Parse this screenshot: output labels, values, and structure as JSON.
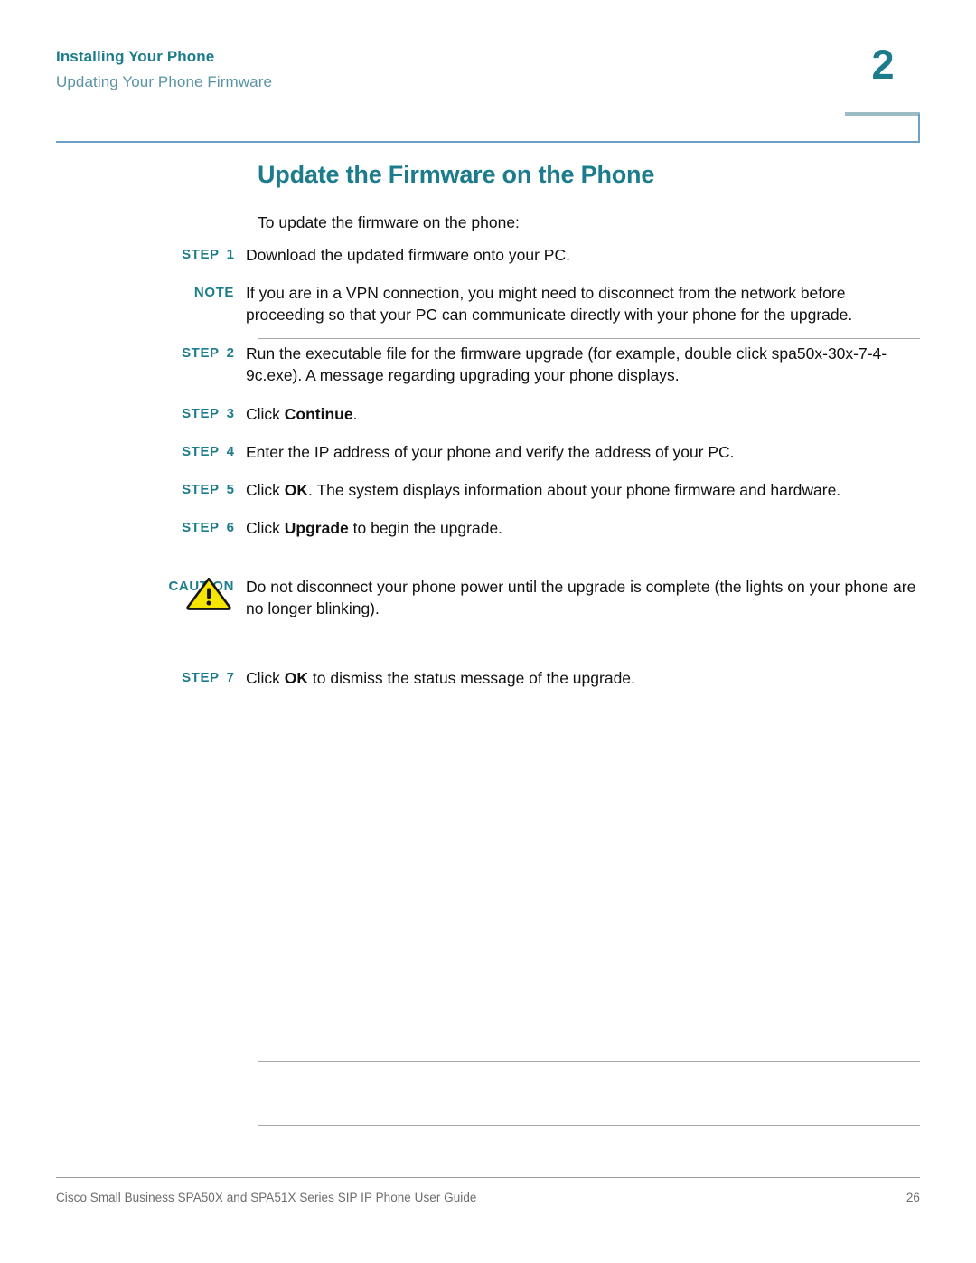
{
  "header": {
    "chapter_title": "Installing Your Phone",
    "section_title": "Updating Your Phone Firmware",
    "chapter_number": "2"
  },
  "main": {
    "section_title": "Update the Firmware on the Phone",
    "intro": "To update the firmware on the phone:",
    "step_label": "STEP",
    "note_label": "NOTE",
    "caution_label": "CAUTION",
    "caution_icon": "warning-triangle-icon",
    "rows": [
      {
        "kind": "step",
        "label": "STEP",
        "number": "1",
        "text": "Download the updated firmware onto your PC."
      },
      {
        "kind": "note",
        "label": "NOTE",
        "number": "",
        "text": "If you are in a VPN connection, you might need to disconnect from the network before proceeding so that your PC can communicate directly with your phone for the upgrade."
      },
      {
        "kind": "step",
        "label": "STEP",
        "number": "2",
        "text": "Run the executable file for the firmware upgrade (for example, double click spa50x-30x-7-4-9c.exe). A message regarding upgrading your phone displays."
      },
      {
        "kind": "step",
        "label": "STEP",
        "number": "3",
        "text_before": "Click ",
        "text_bold": "Continue",
        "text_after": "."
      },
      {
        "kind": "step",
        "label": "STEP",
        "number": "4",
        "text": "Enter the IP address of your phone and verify the address of your PC."
      },
      {
        "kind": "step",
        "label": "STEP",
        "number": "5",
        "text_before": "Click ",
        "text_bold": "OK",
        "text_after": ". The system displays information about your phone firmware and hardware."
      },
      {
        "kind": "step",
        "label": "STEP",
        "number": "6",
        "text_before": "Click ",
        "text_bold": "Upgrade",
        "text_after": " to begin the upgrade."
      },
      {
        "kind": "caution",
        "label": "CAUTION",
        "number": "",
        "text": "Do not disconnect your phone power until the upgrade is complete (the lights on your phone are no longer blinking)."
      },
      {
        "kind": "step",
        "label": "STEP",
        "number": "7",
        "text_before": "Click ",
        "text_bold": "OK",
        "text_after": " to dismiss the status message of the upgrade."
      }
    ]
  },
  "footer": {
    "document_title": "Cisco Small Business SPA50X and SPA51X Series SIP IP Phone User Guide",
    "page_number": "26"
  },
  "colors": {
    "teal": "#1c7c8c",
    "teal_light": "#5a94a4",
    "rule_blue": "#6e9fc6",
    "rule_gray": "#a7a7a7",
    "footer_gray": "#6d6d6d",
    "warning_yellow": "#f5e400"
  }
}
